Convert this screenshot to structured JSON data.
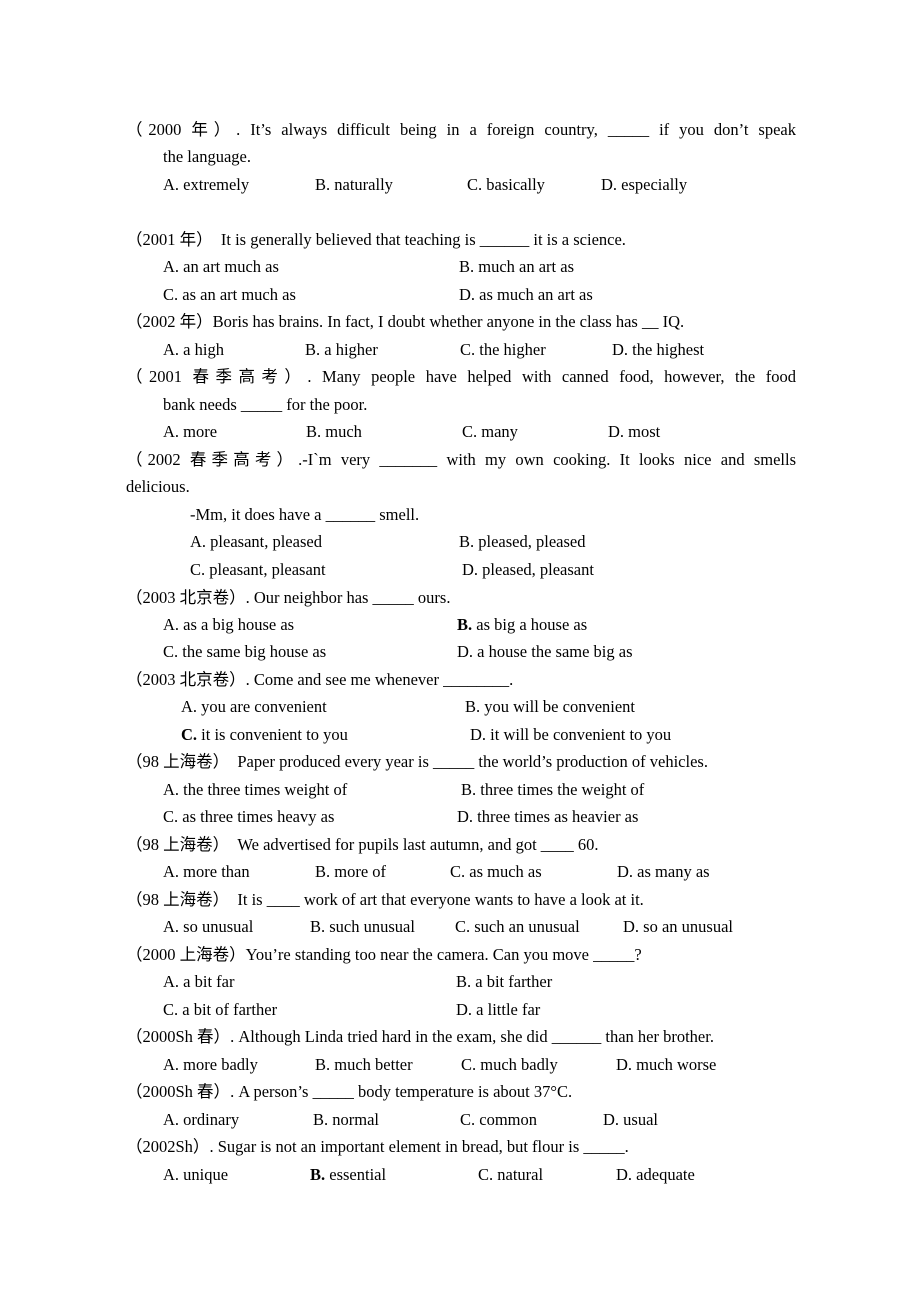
{
  "questions": [
    {
      "source": "（2000 年）",
      "stem": ". It’s always difficult being in a foreign country, _____ if you don’t speak",
      "stem_cont": "the language.",
      "options": [
        "A. extremely",
        "B. naturally",
        "C. basically",
        "D. especially"
      ]
    },
    {
      "source": "（2001 年）",
      "stem": "  It is generally believed that teaching is ______ it is a science.",
      "options": [
        "A. an art much as",
        "B. much an art as",
        "C. as an art much as",
        "D. as much an art as"
      ]
    },
    {
      "source": "（2002 年）",
      "stem": "Boris has brains. In fact, I doubt whether anyone in the class has __ IQ.",
      "options": [
        "A. a high",
        "B. a higher",
        "C. the higher",
        "D. the highest"
      ]
    },
    {
      "source": "（2001 春季高考）",
      "stem": ". Many people have helped with canned food, however, the food",
      "stem_cont": "bank needs _____ for the poor.",
      "options": [
        "A. more",
        "B. much",
        "C. many",
        "D. most"
      ]
    },
    {
      "source": "（2002 春季高考）",
      "stem": ".-I`m very _______ with my own cooking. It looks nice and smells",
      "stem_cont": "delicious.",
      "dialog": "-Mm, it does have a ______ smell.",
      "options": [
        "A. pleasant, pleased",
        "B. pleased, pleased",
        "C. pleasant, pleasant",
        "D. pleased, pleasant"
      ]
    },
    {
      "source": "（2003 北京卷）",
      "stem": ". Our neighbor has _____ ours.",
      "options": [
        "A. as a big house as",
        "as big a house as",
        "C. the same big house as",
        "D. a house the same big as"
      ],
      "bold_letter": "B."
    },
    {
      "source": "（2003 北京卷）",
      "stem": ". Come and see me whenever ________.",
      "options": [
        "A. you are convenient",
        "B. you will be convenient",
        "it is convenient to you",
        "D. it will be convenient to you"
      ],
      "bold_letter": "C."
    },
    {
      "source": "（98 上海卷）",
      "stem": "  Paper produced every year is _____ the world’s production of vehicles.",
      "options": [
        "A. the three times weight of",
        "B. three times the weight of",
        "C. as three times heavy as",
        "D. three times as heavier as"
      ]
    },
    {
      "source": "（98 上海卷）",
      "stem": "  We advertised for pupils last autumn, and got ____ 60.",
      "options": [
        "A. more than",
        "B. more of",
        "C. as much as",
        "D. as many as"
      ]
    },
    {
      "source": "（98 上海卷）",
      "stem": "  It is ____ work of art that everyone wants to have a look at it.",
      "options": [
        "A. so unusual",
        "B. such unusual",
        "C. such an unusual",
        "D. so an unusual"
      ]
    },
    {
      "source": "（2000 上海卷）",
      "stem": "You’re standing too near the camera. Can you move _____?",
      "options": [
        "A. a bit far",
        "B. a bit farther",
        "C. a bit of farther",
        "D. a little far"
      ]
    },
    {
      "source": "（2000Sh 春）",
      "stem": ". Although Linda tried hard in the exam, she did ______ than her brother.",
      "options": [
        "A. more badly",
        "B. much better",
        "C. much badly",
        "D. much worse"
      ]
    },
    {
      "source": "（2000Sh 春）",
      "stem": ". A person’s _____ body temperature is about 37°C.",
      "options": [
        "A. ordinary",
        "B. normal",
        "C. common",
        "D. usual"
      ]
    },
    {
      "source": "（2002Sh）",
      "stem": ". Sugar is not an important element in bread, but flour is _____.",
      "options": [
        "A. unique",
        "essential",
        "C. natural",
        "D. adequate"
      ],
      "bold_letter": "B."
    }
  ]
}
